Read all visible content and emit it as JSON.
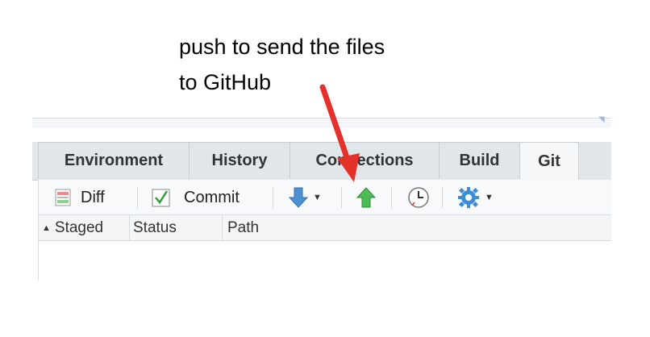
{
  "annotation": {
    "line1": "push to send the files",
    "line2": "to GitHub",
    "arrow_color": "#e4322b"
  },
  "tabs": [
    {
      "label": "Environment"
    },
    {
      "label": "History"
    },
    {
      "label": "Connections"
    },
    {
      "label": "Build"
    },
    {
      "label": "Git",
      "active": true
    }
  ],
  "toolbar": {
    "diff_label": "Diff",
    "commit_label": "Commit",
    "pull_icon": "blue-down-arrow-icon",
    "push_icon": "green-up-arrow-icon",
    "history_icon": "clock-icon",
    "settings_icon": "gear-icon"
  },
  "columns": {
    "staged": "Staged",
    "status": "Status",
    "path": "Path",
    "sort_indicator": "▲"
  },
  "colors": {
    "push_green": "#3fae49",
    "pull_blue": "#3a86c8",
    "gear_blue": "#3b8ed6"
  }
}
